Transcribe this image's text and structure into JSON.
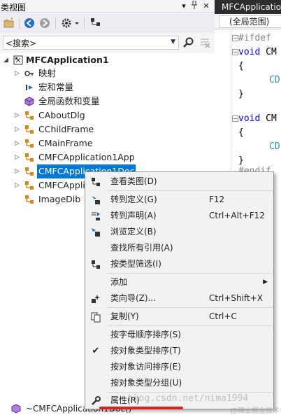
{
  "class_view": {
    "title": "类视图",
    "title_controls": {
      "dropdown": "▾",
      "pin": "📌",
      "close": "✕"
    },
    "search": {
      "placeholder": "<搜索>",
      "value": "<搜索>"
    },
    "tree": {
      "root": "MFCApplication1",
      "items": [
        {
          "label": "映射"
        },
        {
          "label": "宏和常量"
        },
        {
          "label": "全局函数和变量"
        },
        {
          "label": "CAboutDlg"
        },
        {
          "label": "CChildFrame"
        },
        {
          "label": "CMainFrame"
        },
        {
          "label": "CMFCApplication1App"
        },
        {
          "label": "CMFCApplication1Doc"
        },
        {
          "label": "CMFCAppli"
        },
        {
          "label": "ImageDib"
        }
      ],
      "bottom_item": "~CMFCApplication1Doc()"
    }
  },
  "editor": {
    "tab_title": "MFCApplicatio",
    "scope": "(全局范围)",
    "lines": [
      {
        "pre": "#ifdef"
      },
      {
        "kw": "void",
        "id": "CM"
      },
      {
        "text": "{"
      },
      {
        "id": "CD"
      },
      {
        "text": "}"
      },
      {
        "text": ""
      },
      {
        "kw": "void",
        "id": "CM"
      },
      {
        "text": "{"
      },
      {
        "id": "CD"
      },
      {
        "text": "}"
      },
      {
        "pre": "#endif"
      }
    ]
  },
  "context_menu": {
    "items": [
      {
        "label": "查看类图(D)",
        "key": ""
      },
      {
        "label": "转到定义(G)",
        "key": "F12"
      },
      {
        "label": "转到声明(A)",
        "key": "Ctrl+Alt+F12"
      },
      {
        "label": "浏览定义(B)",
        "key": ""
      },
      {
        "label": "查找所有引用(A)",
        "key": ""
      },
      {
        "label": "按类型筛选(I)",
        "key": ""
      },
      {
        "label": "添加",
        "key": ""
      },
      {
        "label": "类向导(Z)...",
        "key": "Ctrl+Shift+X"
      },
      {
        "label": "复制(Y)",
        "key": "Ctrl+C"
      },
      {
        "label": "按字母顺序排序(S)",
        "key": ""
      },
      {
        "label": "按对象类型排序(T)",
        "key": ""
      },
      {
        "label": "按对象访问排序(E)",
        "key": ""
      },
      {
        "label": "按对象类型分组(U)",
        "key": ""
      },
      {
        "label": "属性(R)",
        "key": ""
      }
    ]
  },
  "watermark": "blog.csdn.net/nima1994",
  "watermark2": "@稀土掘金技术社区",
  "colors": {
    "selection": "#0078d7",
    "menu_bg": "#f2f2f2",
    "highlight_mark": "#e0201b",
    "keyword": "#0000ff",
    "type": "#2b91af"
  }
}
